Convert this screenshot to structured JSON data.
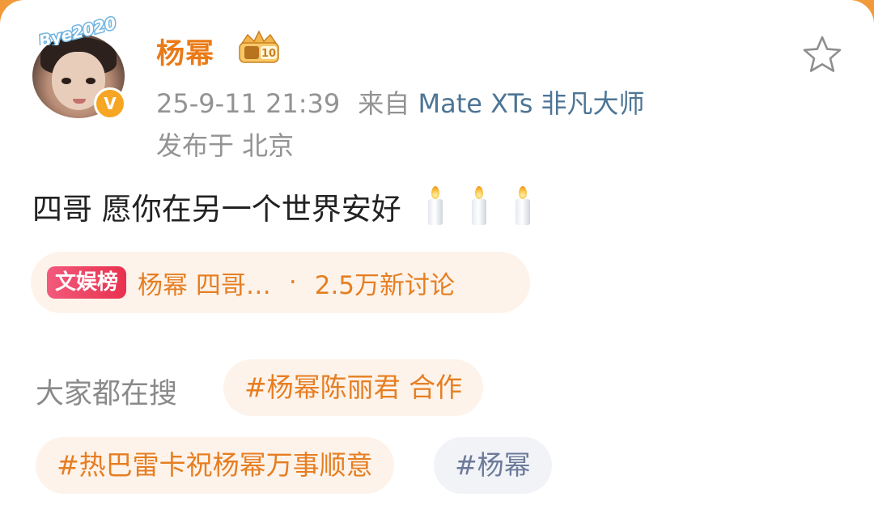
{
  "post": {
    "author": {
      "name": "杨幂",
      "avatar_sticker": "Bye2020",
      "verified_badge": "V",
      "level_badge_icon": "crown-level-badge-icon",
      "level_badge_number": "10"
    },
    "timestamp": "25-9-11 21:39",
    "source_prefix": "来自",
    "device": "Mate XTs 非凡大师",
    "location": "发布于 北京",
    "text": "四哥 愿你在另一个世界安好",
    "emojis": [
      "candle-icon",
      "candle-icon",
      "candle-icon"
    ],
    "favorite_icon": "star-outline-icon"
  },
  "hot_topic": {
    "tag": "文娱榜",
    "title": "杨幂 四哥…",
    "separator": "·",
    "discussion_count": "2.5万新讨论"
  },
  "trending": {
    "label": "大家都在搜",
    "chips": [
      "#杨幂陈丽君 合作",
      "#热巴雷卡祝杨幂万事顺意",
      "#杨幂"
    ]
  },
  "colors": {
    "accent_orange": "#ea7a16",
    "device_blue": "#4d7596",
    "muted_gray": "#939393",
    "hot_tag_red": "#e8314e",
    "chip_bg": "#fdf3ea",
    "page_top_orange": "#f29a3a"
  }
}
